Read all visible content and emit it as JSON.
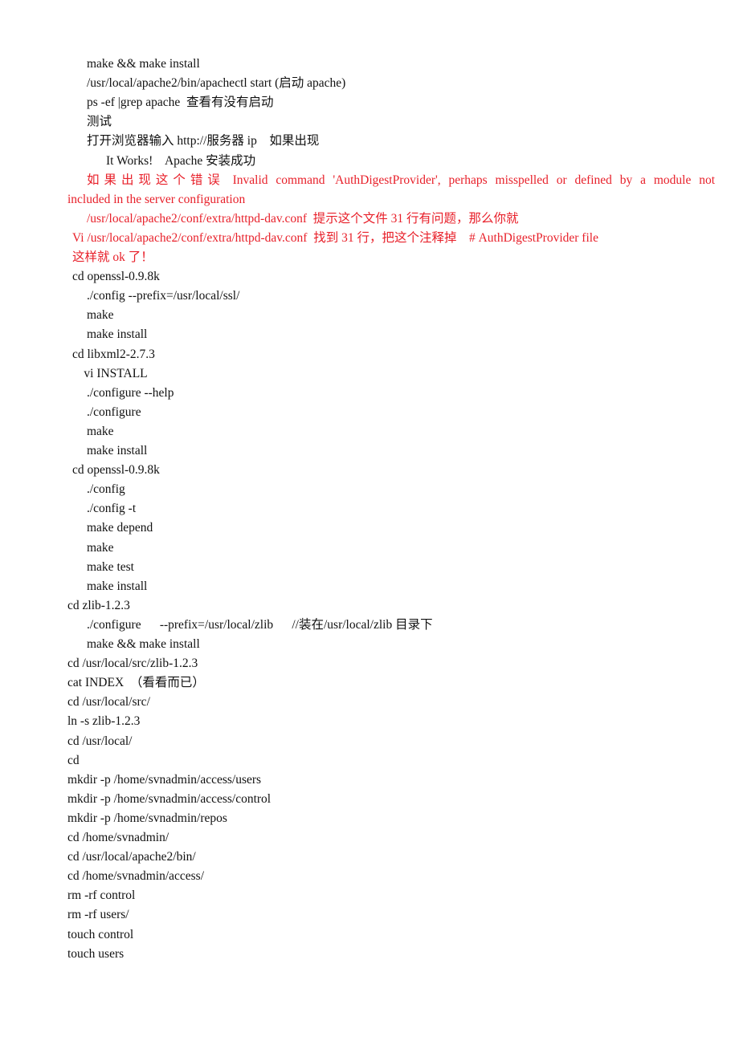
{
  "document": {
    "accent_color": "#e8202a",
    "lines": [
      {
        "text": "make && make install",
        "indent": 1,
        "red": false
      },
      {
        "text": "/usr/local/apache2/bin/apachectl start (启动 apache)",
        "indent": 1,
        "red": false
      },
      {
        "text": "ps -ef |grep apache  查看有没有启动",
        "indent": 1,
        "red": false
      },
      {
        "text": "测试",
        "indent": 1,
        "red": false
      },
      {
        "text": "打开浏览器输入 http://服务器 ip    如果出现",
        "indent": 1,
        "red": false
      },
      {
        "text": "It Works!    Apache 安装成功",
        "indent": 2,
        "red": false
      },
      {
        "text": "如果出现这个错误 Invalid command 'AuthDigestProvider', perhaps misspelled or defined by a module not",
        "indent": 1,
        "red": true,
        "justify": true
      },
      {
        "text": "included in the server configuration",
        "indent": 0,
        "red": true
      },
      {
        "text": "/usr/local/apache2/conf/extra/httpd-dav.conf  提示这个文件 31 行有问题，那么你就",
        "indent": 1,
        "red": true
      },
      {
        "text": "Vi /usr/local/apache2/conf/extra/httpd-dav.conf  找到 31 行，把这个注释掉    # AuthDigestProvider file",
        "indent": 0.25,
        "red": true
      },
      {
        "text": "这样就 ok 了！",
        "indent": 0.25,
        "red": true
      },
      {
        "text": "cd openssl-0.9.8k",
        "indent": 0.25,
        "red": false
      },
      {
        "text": "./config --prefix=/usr/local/ssl/",
        "indent": 1,
        "red": false
      },
      {
        "text": "make",
        "indent": 1,
        "red": false
      },
      {
        "text": "make install",
        "indent": 1,
        "red": false
      },
      {
        "text": "cd libxml2-2.7.3",
        "indent": 0.25,
        "red": false
      },
      {
        "text": "vi INSTALL",
        "indent": 0.85,
        "red": false
      },
      {
        "text": "./configure --help",
        "indent": 1,
        "red": false
      },
      {
        "text": "./configure",
        "indent": 1,
        "red": false
      },
      {
        "text": "make",
        "indent": 1,
        "red": false
      },
      {
        "text": "make install",
        "indent": 1,
        "red": false
      },
      {
        "text": "cd openssl-0.9.8k",
        "indent": 0.25,
        "red": false
      },
      {
        "text": "./config",
        "indent": 1,
        "red": false
      },
      {
        "text": "./config -t",
        "indent": 1,
        "red": false
      },
      {
        "text": "make depend",
        "indent": 1,
        "red": false
      },
      {
        "text": "make",
        "indent": 1,
        "red": false
      },
      {
        "text": "make test",
        "indent": 1,
        "red": false
      },
      {
        "text": "make install",
        "indent": 1,
        "red": false
      },
      {
        "text": "cd zlib-1.2.3",
        "indent": 0,
        "red": false
      },
      {
        "text": "./configure      --prefix=/usr/local/zlib      //装在/usr/local/zlib 目录下",
        "indent": 1,
        "red": false
      },
      {
        "text": "make && make install",
        "indent": 1,
        "red": false
      },
      {
        "text": "cd /usr/local/src/zlib-1.2.3",
        "indent": 0,
        "red": false
      },
      {
        "text": "cat INDEX  （看看而已）",
        "indent": 0,
        "red": false
      },
      {
        "text": "cd /usr/local/src/",
        "indent": 0,
        "red": false
      },
      {
        "text": "ln -s zlib-1.2.3",
        "indent": 0,
        "red": false
      },
      {
        "text": "cd /usr/local/",
        "indent": 0,
        "red": false
      },
      {
        "text": "cd",
        "indent": 0,
        "red": false
      },
      {
        "text": "mkdir -p /home/svnadmin/access/users",
        "indent": 0,
        "red": false
      },
      {
        "text": "mkdir -p /home/svnadmin/access/control",
        "indent": 0,
        "red": false
      },
      {
        "text": "mkdir -p /home/svnadmin/repos",
        "indent": 0,
        "red": false
      },
      {
        "text": "cd /home/svnadmin/",
        "indent": 0,
        "red": false
      },
      {
        "text": "cd /usr/local/apache2/bin/",
        "indent": 0,
        "red": false
      },
      {
        "text": "cd /home/svnadmin/access/",
        "indent": 0,
        "red": false
      },
      {
        "text": "rm -rf control",
        "indent": 0,
        "red": false
      },
      {
        "text": "rm -rf users/",
        "indent": 0,
        "red": false
      },
      {
        "text": "touch control",
        "indent": 0,
        "red": false
      },
      {
        "text": "touch users",
        "indent": 0,
        "red": false
      }
    ]
  }
}
